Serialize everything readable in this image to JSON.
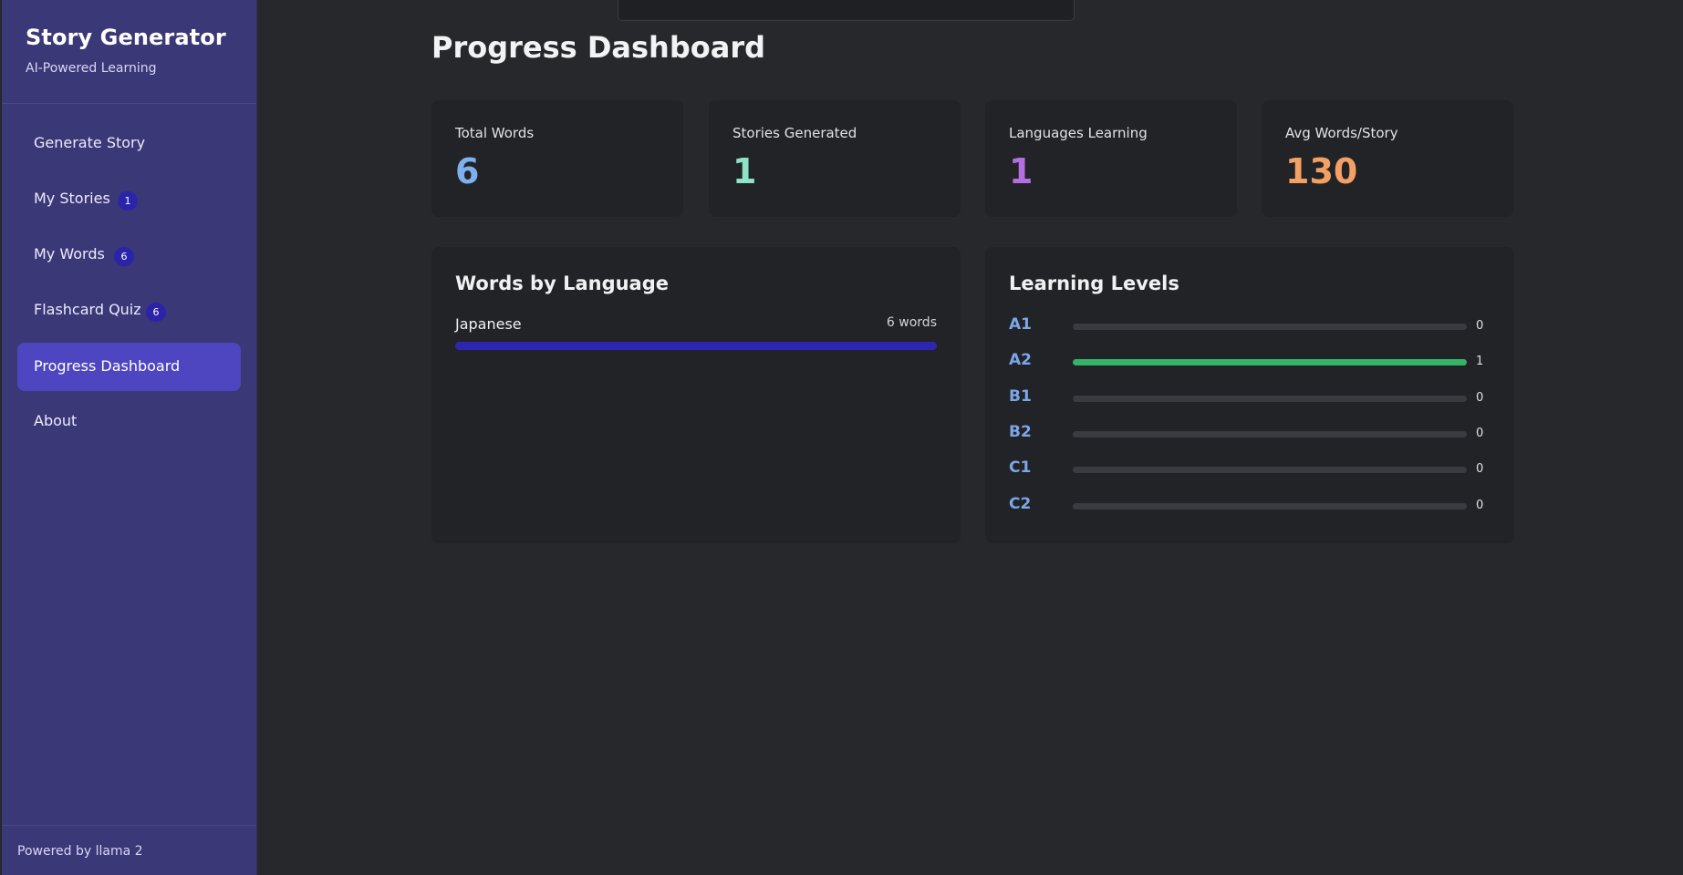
{
  "brand": {
    "title": "Story Generator",
    "subtitle": "AI-Powered Learning"
  },
  "nav": [
    {
      "label": "Generate Story",
      "badge": null,
      "active": false
    },
    {
      "label": "My Stories",
      "badge": "1",
      "active": false
    },
    {
      "label": "My Words",
      "badge": "6",
      "active": false
    },
    {
      "label": "Flashcard Quiz",
      "badge": "6",
      "active": false
    },
    {
      "label": "Progress Dashboard",
      "badge": null,
      "active": true
    },
    {
      "label": "About",
      "badge": null,
      "active": false
    }
  ],
  "footer": {
    "text": "Powered by llama 2"
  },
  "main": {
    "title": "Progress Dashboard"
  },
  "stats": [
    {
      "label": "Total Words",
      "value": "6",
      "color": "#7eb0f0"
    },
    {
      "label": "Stories Generated",
      "value": "1",
      "color": "#8de3c4"
    },
    {
      "label": "Languages Learning",
      "value": "1",
      "color": "#b46ee0"
    },
    {
      "label": "Avg Words/Story",
      "value": "130",
      "color": "#f3a064"
    }
  ],
  "words_by_language": {
    "title": "Words by Language",
    "items": [
      {
        "language": "Japanese",
        "count_label": "6 words",
        "fraction": 1.0
      }
    ]
  },
  "learning_levels": {
    "title": "Learning Levels",
    "levels": [
      {
        "name": "A1",
        "count": "0",
        "fraction": 0
      },
      {
        "name": "A2",
        "count": "1",
        "fraction": 1
      },
      {
        "name": "B1",
        "count": "0",
        "fraction": 0
      },
      {
        "name": "B2",
        "count": "0",
        "fraction": 0
      },
      {
        "name": "C1",
        "count": "0",
        "fraction": 0
      },
      {
        "name": "C2",
        "count": "0",
        "fraction": 0
      }
    ]
  },
  "colors": {
    "sidebar": "#3b3878",
    "active_nav": "#4e46c0",
    "badge": "#2b24a8",
    "language_bar": "#2f25b4",
    "level_bar": "#35b368",
    "level_label": "#7ba6e8"
  }
}
